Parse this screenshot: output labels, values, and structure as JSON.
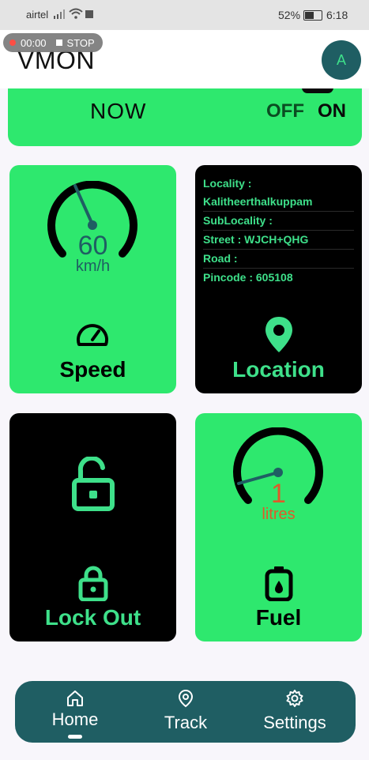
{
  "status_bar": {
    "carrier": "airtel",
    "battery": "52%",
    "time": "6:18"
  },
  "recording": {
    "timer": "00:00",
    "stop_label": "STOP"
  },
  "app_bar": {
    "title": "VMON",
    "avatar_initial": "A"
  },
  "top_card": {
    "now_label": "NOW",
    "off_label": "OFF",
    "on_label": "ON"
  },
  "speed_card": {
    "value": "60",
    "unit": "km/h",
    "title": "Speed",
    "icon": "speedometer-icon"
  },
  "location_card": {
    "lines": [
      "Locality :",
      "Kalitheerthalkuppam",
      "SubLocality :",
      "Street : WJCH+QHG",
      "Road :",
      "Pincode : 605108"
    ],
    "title": "Location",
    "icon": "location-pin-icon"
  },
  "lock_card": {
    "title": "Lock Out",
    "icon": "unlock-icon"
  },
  "fuel_card": {
    "value": "1",
    "unit": "litres",
    "title": "Fuel",
    "icon": "fuel-can-icon"
  },
  "bottom_nav": {
    "items": [
      {
        "label": "Home",
        "icon": "home-icon"
      },
      {
        "label": "Track",
        "icon": "location-icon"
      },
      {
        "label": "Settings",
        "icon": "gear-icon"
      }
    ]
  },
  "colors": {
    "accent_green": "#2ee86e",
    "dark_teal": "#1f5e63",
    "fuel_orange": "#e0592a"
  }
}
